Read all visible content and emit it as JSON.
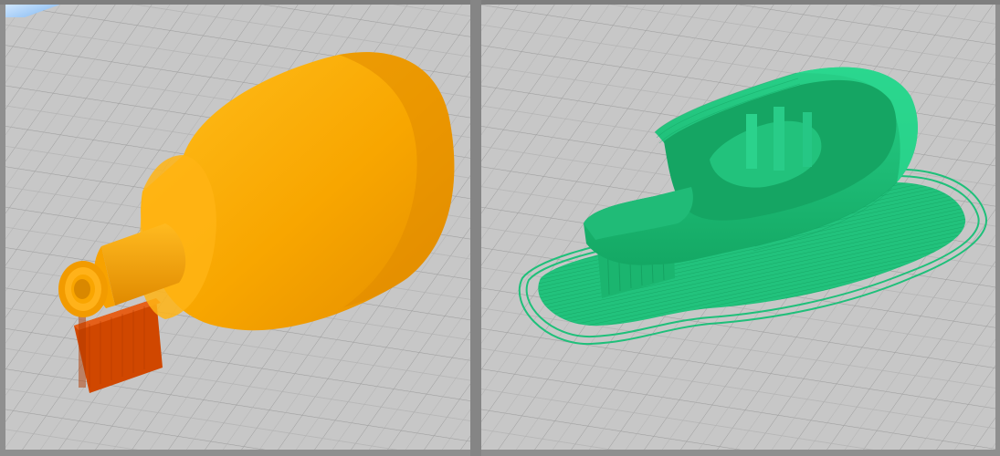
{
  "views": [
    {
      "name": "model-view",
      "bed_color": "#c6c6c6",
      "grid_color": "#9c9c9c",
      "model_color": "#f6a400",
      "support_color": "#d44a00"
    },
    {
      "name": "sliced-preview",
      "bed_color": "#c6c6c6",
      "grid_color": "#9c9c9c",
      "model_color": "#1fc07a",
      "support_color": "#19b36e"
    }
  ],
  "icons": {
    "bed": "build-plate-grid"
  }
}
